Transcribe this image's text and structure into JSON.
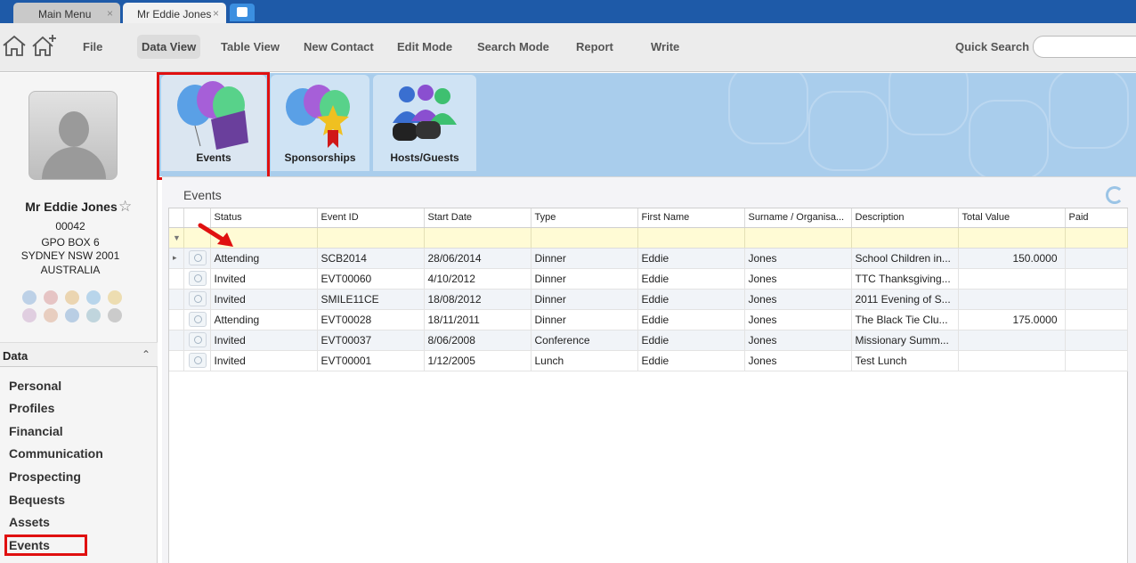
{
  "window_tabs": [
    {
      "label": "Main Menu",
      "close": "×"
    },
    {
      "label": "Mr Eddie Jones",
      "close": "×"
    }
  ],
  "toolbar": {
    "menu": [
      "File",
      "Data View",
      "Table View",
      "New Contact",
      "Edit Mode",
      "Search Mode",
      "Report",
      "Write"
    ],
    "active": "Data View",
    "quick_search_label": "Quick Search",
    "quick_search_value": ""
  },
  "contact": {
    "name": "Mr Eddie Jones",
    "id": "00042",
    "address_line1": "GPO BOX 6",
    "address_line2": "SYDNEY NSW 2001",
    "country": "AUSTRALIA"
  },
  "sidebar": {
    "section_title": "Data",
    "collapse_glyph": "⌃",
    "items": [
      "Personal",
      "Profiles",
      "Financial",
      "Communication",
      "Prospecting",
      "Bequests",
      "Assets",
      "Events"
    ],
    "active": "Events"
  },
  "feature_tabs": [
    {
      "label": "Events",
      "icon": "balloons-envelope-icon"
    },
    {
      "label": "Sponsorships",
      "icon": "balloons-star-icon"
    },
    {
      "label": "Hosts/Guests",
      "icon": "people-binoculars-icon"
    }
  ],
  "panel": {
    "title": "Events",
    "columns": [
      "Status",
      "Event ID",
      "Start Date",
      "Type",
      "First Name",
      "Surname / Organisa...",
      "Description",
      "Total Value",
      "Paid"
    ],
    "filter_glyph": "▼",
    "current_row_glyph": "▸",
    "rows": [
      {
        "status": "Attending",
        "event_id": "SCB2014",
        "start_date": "28/06/2014",
        "type": "Dinner",
        "first_name": "Eddie",
        "surname": "Jones",
        "description": "School Children in...",
        "total_value": "150.0000",
        "paid": ""
      },
      {
        "status": "Invited",
        "event_id": "EVT00060",
        "start_date": "4/10/2012",
        "type": "Dinner",
        "first_name": "Eddie",
        "surname": "Jones",
        "description": "TTC Thanksgiving...",
        "total_value": "",
        "paid": ""
      },
      {
        "status": "Invited",
        "event_id": "SMILE11CE",
        "start_date": "18/08/2012",
        "type": "Dinner",
        "first_name": "Eddie",
        "surname": "Jones",
        "description": "2011 Evening of S...",
        "total_value": "",
        "paid": ""
      },
      {
        "status": "Attending",
        "event_id": "EVT00028",
        "start_date": "18/11/2011",
        "type": "Dinner",
        "first_name": "Eddie",
        "surname": "Jones",
        "description": "The Black Tie Clu...",
        "total_value": "175.0000",
        "paid": ""
      },
      {
        "status": "Invited",
        "event_id": "EVT00037",
        "start_date": "8/06/2008",
        "type": "Conference",
        "first_name": "Eddie",
        "surname": "Jones",
        "description": "Missionary Summ...",
        "total_value": "",
        "paid": ""
      },
      {
        "status": "Invited",
        "event_id": "EVT00001",
        "start_date": "1/12/2005",
        "type": "Lunch",
        "first_name": "Eddie",
        "surname": "Jones",
        "description": "Test Lunch",
        "total_value": "",
        "paid": ""
      }
    ]
  },
  "colors": {
    "title_bar": "#1e5aa8",
    "highlight_box": "#e01010",
    "filter_row": "#fffbd5",
    "background_area": "#a9cdec"
  }
}
